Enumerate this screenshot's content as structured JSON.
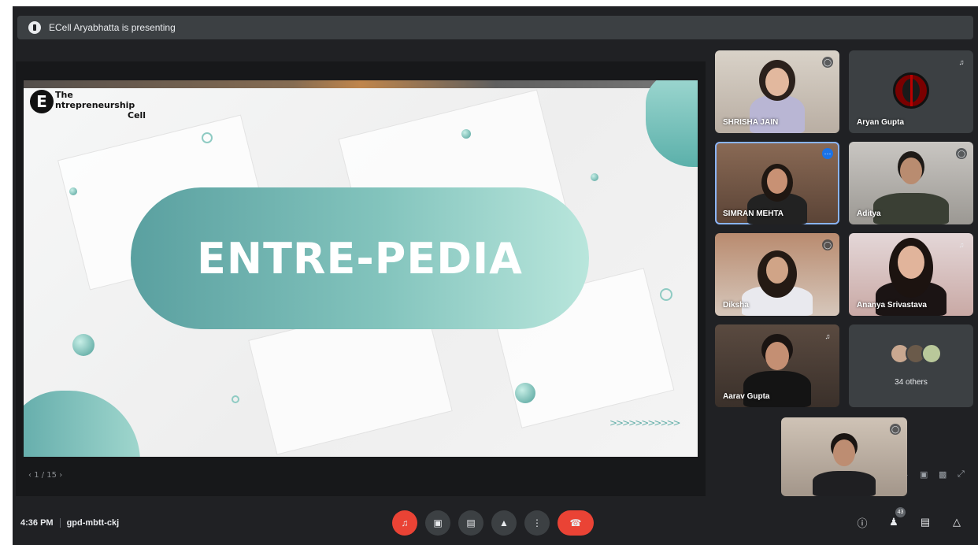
{
  "banner": {
    "text": "ECell Aryabhatta is presenting"
  },
  "slide": {
    "logo_letter": "E",
    "logo_line1": "The",
    "logo_line2": "ntrepreneurship",
    "logo_line3": "Cell",
    "title": "ENTRE-PEDIA",
    "chevrons": ">>>>>>>>>>>",
    "page_indicator": "1 / 15"
  },
  "participants": [
    {
      "name": "SHRISHA JAIN"
    },
    {
      "name": "Aryan Gupta"
    },
    {
      "name": "SIMRAN MEHTA"
    },
    {
      "name": "Aditya"
    },
    {
      "name": "Diksha"
    },
    {
      "name": "Ananya Srivastava"
    },
    {
      "name": "Aarav Gupta"
    },
    {
      "name": ""
    }
  ],
  "others": {
    "label": "34 others"
  },
  "meeting": {
    "time": "4:36 PM",
    "code": "gpd-mbtt-ckj",
    "participants_count": "43"
  },
  "colors": {
    "accent": "#1a73e8",
    "end_call": "#ea4335",
    "background": "#202124",
    "teal": "#5aa0a0"
  }
}
